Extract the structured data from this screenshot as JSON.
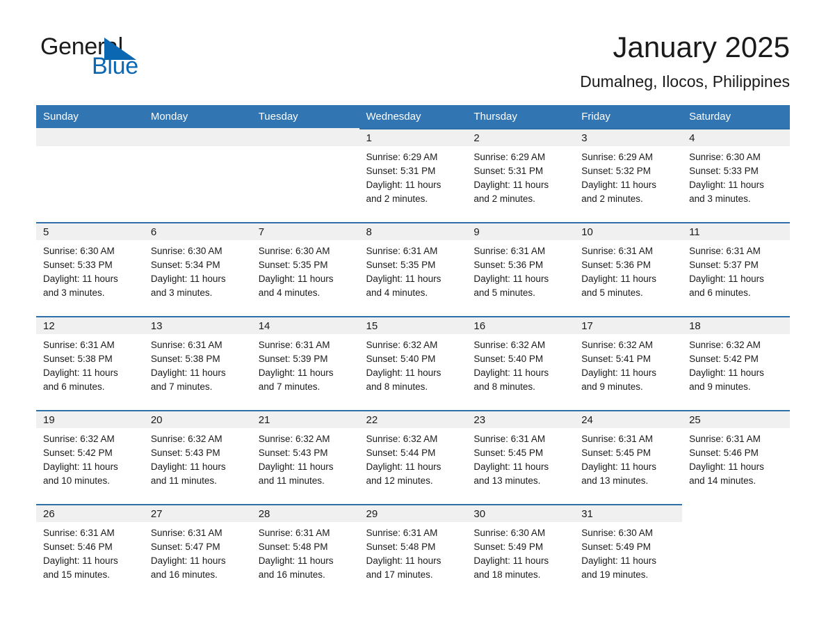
{
  "brand": {
    "name_part1": "General",
    "name_part2": "Blue",
    "triangle_color": "#0b67b2"
  },
  "header": {
    "title": "January 2025",
    "subtitle": "Dumalneg, Ilocos, Philippines"
  },
  "theme": {
    "header_blue": "#3275b3",
    "row_rule_blue": "#2f6fa8",
    "daynum_band": "#f0f0f0",
    "text": "#1a1a1a"
  },
  "weekdays": [
    "Sunday",
    "Monday",
    "Tuesday",
    "Wednesday",
    "Thursday",
    "Friday",
    "Saturday"
  ],
  "weeks": [
    [
      {
        "day": "",
        "lines": []
      },
      {
        "day": "",
        "lines": []
      },
      {
        "day": "",
        "lines": []
      },
      {
        "day": "1",
        "lines": [
          "Sunrise: 6:29 AM",
          "Sunset: 5:31 PM",
          "Daylight: 11 hours",
          "and 2 minutes."
        ]
      },
      {
        "day": "2",
        "lines": [
          "Sunrise: 6:29 AM",
          "Sunset: 5:31 PM",
          "Daylight: 11 hours",
          "and 2 minutes."
        ]
      },
      {
        "day": "3",
        "lines": [
          "Sunrise: 6:29 AM",
          "Sunset: 5:32 PM",
          "Daylight: 11 hours",
          "and 2 minutes."
        ]
      },
      {
        "day": "4",
        "lines": [
          "Sunrise: 6:30 AM",
          "Sunset: 5:33 PM",
          "Daylight: 11 hours",
          "and 3 minutes."
        ]
      }
    ],
    [
      {
        "day": "5",
        "lines": [
          "Sunrise: 6:30 AM",
          "Sunset: 5:33 PM",
          "Daylight: 11 hours",
          "and 3 minutes."
        ]
      },
      {
        "day": "6",
        "lines": [
          "Sunrise: 6:30 AM",
          "Sunset: 5:34 PM",
          "Daylight: 11 hours",
          "and 3 minutes."
        ]
      },
      {
        "day": "7",
        "lines": [
          "Sunrise: 6:30 AM",
          "Sunset: 5:35 PM",
          "Daylight: 11 hours",
          "and 4 minutes."
        ]
      },
      {
        "day": "8",
        "lines": [
          "Sunrise: 6:31 AM",
          "Sunset: 5:35 PM",
          "Daylight: 11 hours",
          "and 4 minutes."
        ]
      },
      {
        "day": "9",
        "lines": [
          "Sunrise: 6:31 AM",
          "Sunset: 5:36 PM",
          "Daylight: 11 hours",
          "and 5 minutes."
        ]
      },
      {
        "day": "10",
        "lines": [
          "Sunrise: 6:31 AM",
          "Sunset: 5:36 PM",
          "Daylight: 11 hours",
          "and 5 minutes."
        ]
      },
      {
        "day": "11",
        "lines": [
          "Sunrise: 6:31 AM",
          "Sunset: 5:37 PM",
          "Daylight: 11 hours",
          "and 6 minutes."
        ]
      }
    ],
    [
      {
        "day": "12",
        "lines": [
          "Sunrise: 6:31 AM",
          "Sunset: 5:38 PM",
          "Daylight: 11 hours",
          "and 6 minutes."
        ]
      },
      {
        "day": "13",
        "lines": [
          "Sunrise: 6:31 AM",
          "Sunset: 5:38 PM",
          "Daylight: 11 hours",
          "and 7 minutes."
        ]
      },
      {
        "day": "14",
        "lines": [
          "Sunrise: 6:31 AM",
          "Sunset: 5:39 PM",
          "Daylight: 11 hours",
          "and 7 minutes."
        ]
      },
      {
        "day": "15",
        "lines": [
          "Sunrise: 6:32 AM",
          "Sunset: 5:40 PM",
          "Daylight: 11 hours",
          "and 8 minutes."
        ]
      },
      {
        "day": "16",
        "lines": [
          "Sunrise: 6:32 AM",
          "Sunset: 5:40 PM",
          "Daylight: 11 hours",
          "and 8 minutes."
        ]
      },
      {
        "day": "17",
        "lines": [
          "Sunrise: 6:32 AM",
          "Sunset: 5:41 PM",
          "Daylight: 11 hours",
          "and 9 minutes."
        ]
      },
      {
        "day": "18",
        "lines": [
          "Sunrise: 6:32 AM",
          "Sunset: 5:42 PM",
          "Daylight: 11 hours",
          "and 9 minutes."
        ]
      }
    ],
    [
      {
        "day": "19",
        "lines": [
          "Sunrise: 6:32 AM",
          "Sunset: 5:42 PM",
          "Daylight: 11 hours",
          "and 10 minutes."
        ]
      },
      {
        "day": "20",
        "lines": [
          "Sunrise: 6:32 AM",
          "Sunset: 5:43 PM",
          "Daylight: 11 hours",
          "and 11 minutes."
        ]
      },
      {
        "day": "21",
        "lines": [
          "Sunrise: 6:32 AM",
          "Sunset: 5:43 PM",
          "Daylight: 11 hours",
          "and 11 minutes."
        ]
      },
      {
        "day": "22",
        "lines": [
          "Sunrise: 6:32 AM",
          "Sunset: 5:44 PM",
          "Daylight: 11 hours",
          "and 12 minutes."
        ]
      },
      {
        "day": "23",
        "lines": [
          "Sunrise: 6:31 AM",
          "Sunset: 5:45 PM",
          "Daylight: 11 hours",
          "and 13 minutes."
        ]
      },
      {
        "day": "24",
        "lines": [
          "Sunrise: 6:31 AM",
          "Sunset: 5:45 PM",
          "Daylight: 11 hours",
          "and 13 minutes."
        ]
      },
      {
        "day": "25",
        "lines": [
          "Sunrise: 6:31 AM",
          "Sunset: 5:46 PM",
          "Daylight: 11 hours",
          "and 14 minutes."
        ]
      }
    ],
    [
      {
        "day": "26",
        "lines": [
          "Sunrise: 6:31 AM",
          "Sunset: 5:46 PM",
          "Daylight: 11 hours",
          "and 15 minutes."
        ]
      },
      {
        "day": "27",
        "lines": [
          "Sunrise: 6:31 AM",
          "Sunset: 5:47 PM",
          "Daylight: 11 hours",
          "and 16 minutes."
        ]
      },
      {
        "day": "28",
        "lines": [
          "Sunrise: 6:31 AM",
          "Sunset: 5:48 PM",
          "Daylight: 11 hours",
          "and 16 minutes."
        ]
      },
      {
        "day": "29",
        "lines": [
          "Sunrise: 6:31 AM",
          "Sunset: 5:48 PM",
          "Daylight: 11 hours",
          "and 17 minutes."
        ]
      },
      {
        "day": "30",
        "lines": [
          "Sunrise: 6:30 AM",
          "Sunset: 5:49 PM",
          "Daylight: 11 hours",
          "and 18 minutes."
        ]
      },
      {
        "day": "31",
        "lines": [
          "Sunrise: 6:30 AM",
          "Sunset: 5:49 PM",
          "Daylight: 11 hours",
          "and 19 minutes."
        ]
      },
      {
        "day": "",
        "lines": []
      }
    ]
  ]
}
